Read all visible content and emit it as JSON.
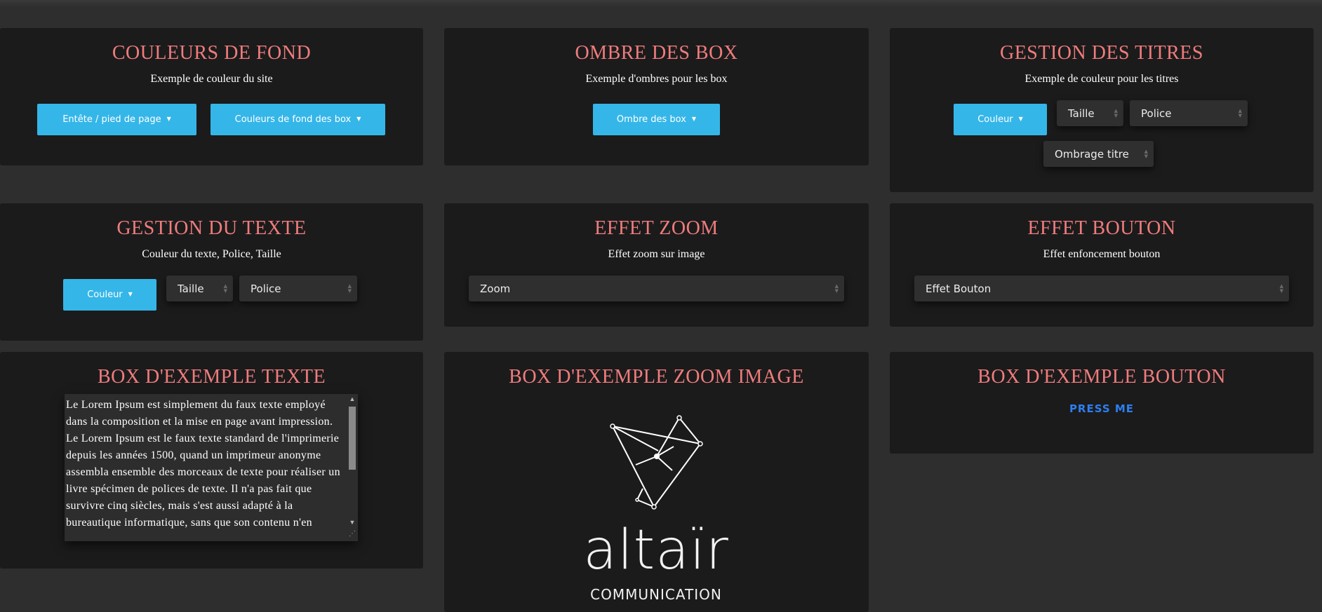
{
  "boxes": {
    "couleurs": {
      "title": "COULEURS DE FOND",
      "subtitle": "Exemple de couleur du site",
      "btn_header": "Entête / pied de page",
      "btn_box_bg": "Couleurs de fond des box"
    },
    "ombre": {
      "title": "OMBRE DES BOX",
      "subtitle": "Exemple d'ombres pour les box",
      "btn_shadow": "Ombre des box"
    },
    "titres": {
      "title": "GESTION DES TITRES",
      "subtitle": "Exemple de couleur pour les titres",
      "btn_color": "Couleur",
      "sel_size": "Taille",
      "sel_font": "Police",
      "sel_shadow": "Ombrage titre"
    },
    "texte": {
      "title": "GESTION DU TEXTE",
      "subtitle": "Couleur du texte, Police, Taille",
      "btn_color": "Couleur",
      "sel_size": "Taille",
      "sel_font": "Police"
    },
    "zoom": {
      "title": "EFFET ZOOM",
      "subtitle": "Effet zoom sur image",
      "sel_zoom": "Zoom"
    },
    "bouton": {
      "title": "EFFET BOUTON",
      "subtitle": "Effet enfoncement bouton",
      "sel_effect": "Effet Bouton"
    },
    "ex_texte": {
      "title": "BOX D'EXEMPLE TEXTE",
      "body": "Le Lorem Ipsum est simplement du faux texte employé dans la composition et la mise en page avant impression. Le Lorem Ipsum est le faux texte standard de l'imprimerie depuis les années 1500, quand un imprimeur anonyme assembla ensemble des morceaux de texte pour réaliser un livre spécimen de polices de texte. Il n'a pas fait que survivre cinq siècles, mais s'est aussi adapté à la bureautique informatique, sans que son contenu n'en"
    },
    "ex_zoom": {
      "title": "BOX D'EXEMPLE ZOOM IMAGE",
      "logo_word": "altaïr",
      "logo_sub": "COMMUNICATION"
    },
    "ex_bouton": {
      "title": "BOX D'EXEMPLE BOUTON",
      "press": "PRESS ME"
    }
  },
  "colors": {
    "page_bg": "#2e2e2e",
    "box_bg": "#1b1b1c",
    "title": "#f07c7c",
    "button": "#35b6e8",
    "link": "#2d7ff0"
  },
  "icons": [
    "caret-down-icon",
    "select-arrows-icon",
    "scroll-up-icon",
    "scroll-down-icon",
    "resize-grip-icon",
    "altair-logo-icon"
  ]
}
